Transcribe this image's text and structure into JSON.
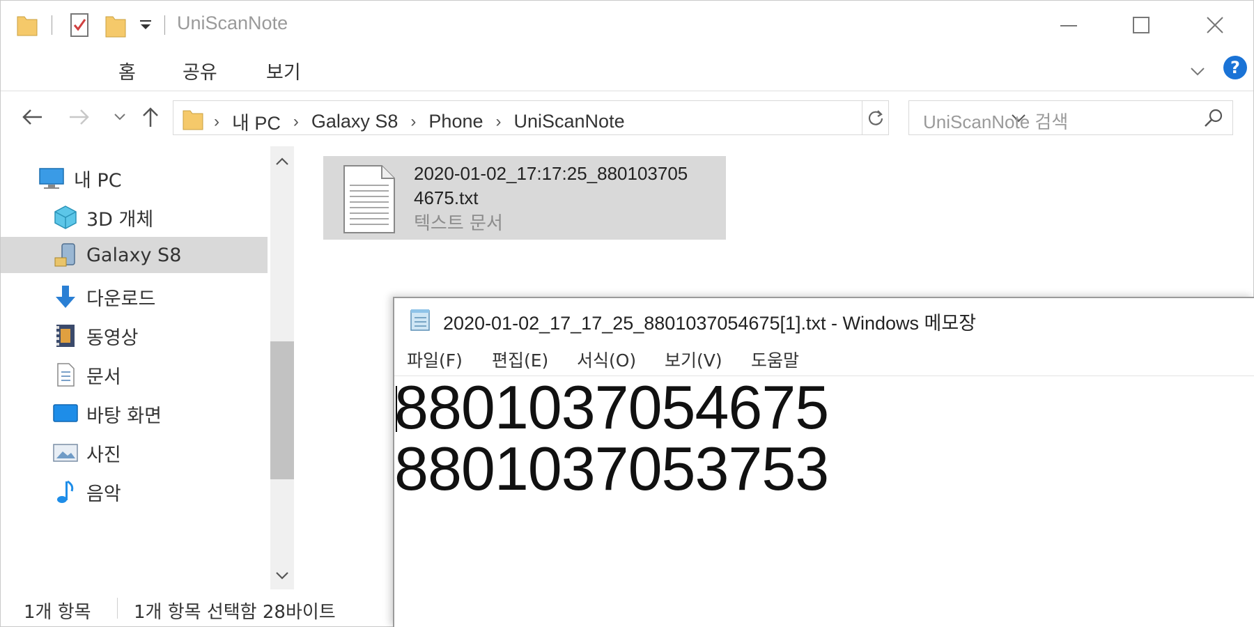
{
  "explorer": {
    "title": "UniScanNote",
    "ribbon_tabs": [
      "홈",
      "공유",
      "보기"
    ],
    "breadcrumb": [
      "내 PC",
      "Galaxy S8",
      "Phone",
      "UniScanNote"
    ],
    "search_placeholder": "UniScanNote 검색",
    "nav_items": [
      {
        "label": "내 PC",
        "icon": "computer-icon"
      },
      {
        "label": "3D 개체",
        "icon": "3d-objects-icon"
      },
      {
        "label": "Galaxy S8",
        "icon": "phone-device-icon",
        "selected": true
      },
      {
        "label": "다운로드",
        "icon": "download-icon"
      },
      {
        "label": "동영상",
        "icon": "video-icon"
      },
      {
        "label": "문서",
        "icon": "document-icon"
      },
      {
        "label": "바탕 화면",
        "icon": "desktop-icon"
      },
      {
        "label": "사진",
        "icon": "pictures-icon"
      },
      {
        "label": "음악",
        "icon": "music-icon"
      }
    ],
    "file": {
      "name_line1": "2020-01-02_17:17:25_880103705",
      "name_line2": "4675.txt",
      "type": "텍스트 문서"
    },
    "status": {
      "count": "1개 항목",
      "selection": "1개 항목 선택함 28바이트"
    },
    "help_label": "?"
  },
  "notepad": {
    "title": "2020-01-02_17_17_25_8801037054675[1].txt - Windows 메모장",
    "menus": [
      "파일(F)",
      "편집(E)",
      "서식(O)",
      "보기(V)",
      "도움말"
    ],
    "lines": [
      "8801037054675",
      "8801037053753"
    ]
  },
  "colors": {
    "accent": "#1a73d6",
    "folder": "#f5c96a",
    "selection": "#d9d9d9"
  }
}
